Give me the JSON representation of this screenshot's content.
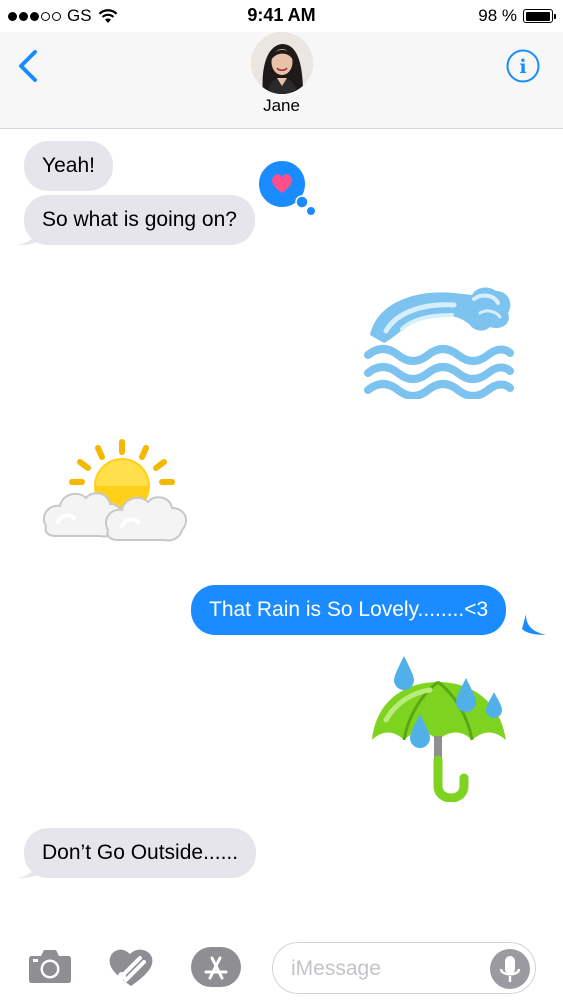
{
  "status_bar": {
    "carrier": "GS",
    "time": "9:41 AM",
    "battery_percent_label": "98 %",
    "battery_level": 0.98,
    "signal_bars_filled": 3,
    "signal_bars_total": 5
  },
  "header": {
    "contact_name": "Jane",
    "back_icon": "chevron-left-icon",
    "info_icon": "info-icon"
  },
  "messages": [
    {
      "direction": "incoming",
      "text": "Yeah!"
    },
    {
      "direction": "incoming",
      "text": "So what is going on?",
      "tapback": "heart"
    },
    {
      "direction": "outgoing",
      "sticker": "water-wave-sticker"
    },
    {
      "direction": "incoming",
      "sticker": "sun-behind-cloud-sticker"
    },
    {
      "direction": "outgoing",
      "text": "That Rain is So Lovely........<3"
    },
    {
      "direction": "outgoing",
      "sticker": "umbrella-rain-sticker"
    },
    {
      "direction": "incoming",
      "text": "Don’t Go Outside......"
    }
  ],
  "input_bar": {
    "placeholder": "iMessage",
    "icons": [
      "camera-icon",
      "digital-touch-icon",
      "app-store-icon",
      "microphone-icon"
    ]
  },
  "colors": {
    "accent": "#1a8cff",
    "incoming_bubble": "#e6e5eb",
    "header_bg": "#f7f7f7"
  }
}
